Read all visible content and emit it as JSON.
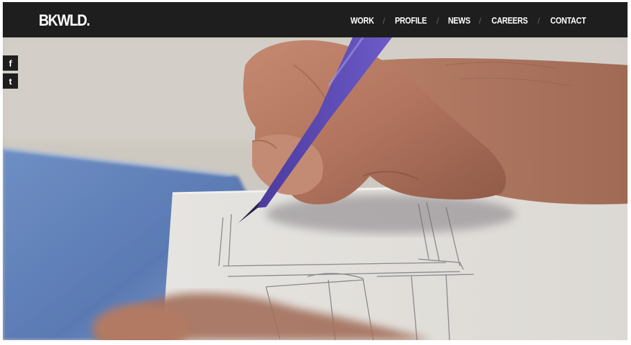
{
  "header": {
    "logo": "BKWLD.",
    "nav": [
      "WORK",
      "PROFILE",
      "NEWS",
      "CAREERS",
      "CONTACT"
    ],
    "separator": "/"
  },
  "social": {
    "facebook_icon": "f",
    "twitter_icon": "t"
  },
  "colors": {
    "header_bg": "#1e1e1e",
    "text": "#ffffff"
  }
}
